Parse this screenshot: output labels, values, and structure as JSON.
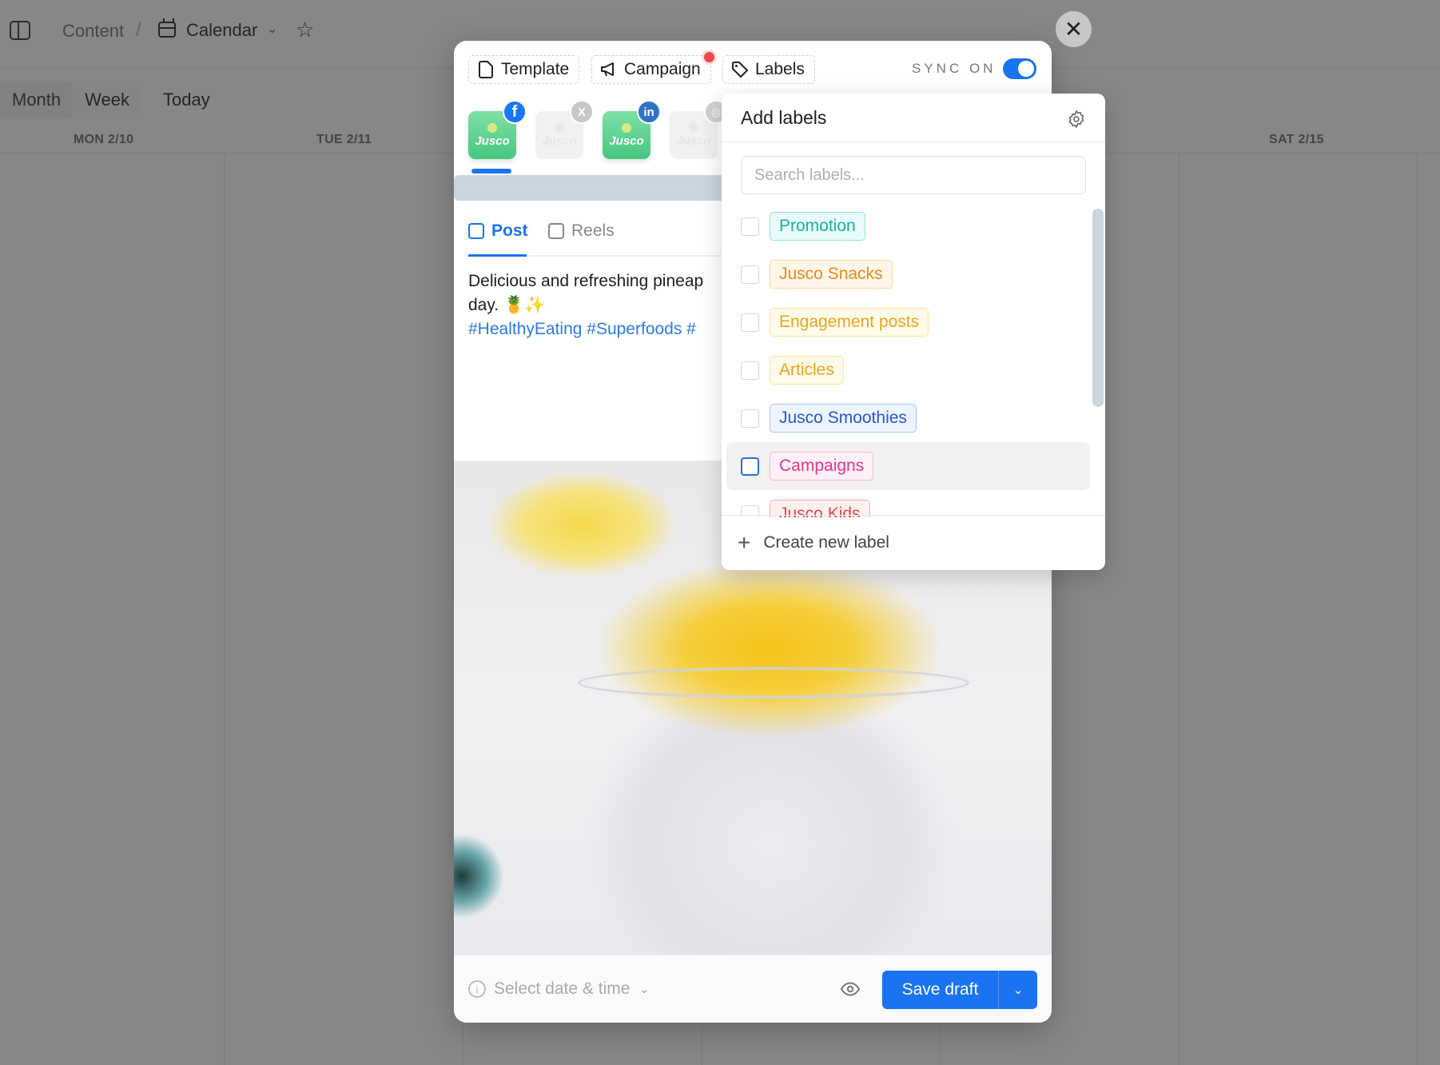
{
  "breadcrumb": {
    "parent": "Content",
    "separator": "/",
    "current": "Calendar"
  },
  "views": {
    "month": "Month",
    "week": "Week",
    "today": "Today",
    "active": "Week"
  },
  "days": [
    "MON 2/10",
    "TUE 2/11",
    "SAT 2/15"
  ],
  "modal": {
    "chips": {
      "template": "Template",
      "campaign": "Campaign",
      "labels": "Labels"
    },
    "sync_label": "SYNC ON",
    "sync_on": true,
    "accounts": [
      {
        "name": "Jusco",
        "network": "facebook",
        "badge": "f",
        "selected": true
      },
      {
        "name": "Jusco",
        "network": "x",
        "badge": "X",
        "selected": false
      },
      {
        "name": "Jusco",
        "network": "linkedin",
        "badge": "in",
        "selected": true
      },
      {
        "name": "Jusco",
        "network": "instagram",
        "badge": "◎",
        "selected": false
      }
    ],
    "tabs": {
      "post": "Post",
      "reels": "Reels",
      "active": "Post"
    },
    "post_text_line1": "Delicious and refreshing pineap",
    "post_text_line2": "day. 🍍✨",
    "post_hashtags": "#HealthyEating #Superfoods #",
    "footer": {
      "date_placeholder": "Select date & time",
      "save_label": "Save draft"
    }
  },
  "labels_popup": {
    "title": "Add labels",
    "search_placeholder": "Search labels...",
    "create_label": "Create new label",
    "labels": [
      {
        "name": "Promotion",
        "color": "#17b3a6",
        "bg": "#e9fbf8",
        "border": "#8fe3d8",
        "checked": false
      },
      {
        "name": "Jusco Snacks",
        "color": "#ec8a1c",
        "bg": "#fff6e8",
        "border": "#fbd49a",
        "checked": false
      },
      {
        "name": "Engagement posts",
        "color": "#e9a51d",
        "bg": "#fffbea",
        "border": "#fbe39a",
        "checked": false
      },
      {
        "name": "Articles",
        "color": "#e9a51d",
        "bg": "#fffbea",
        "border": "#fbe39a",
        "checked": false
      },
      {
        "name": "Jusco Smoothies",
        "color": "#2857c9",
        "bg": "#eef4fe",
        "border": "#a9c4f0",
        "checked": false
      },
      {
        "name": "Campaigns",
        "color": "#e0368f",
        "bg": "#fef0f6",
        "border": "#f6b6d3",
        "checked": false,
        "hovered": true
      },
      {
        "name": "Jusco Kids",
        "color": "#e2444a",
        "bg": "#fff0f0",
        "border": "#f5aaaa",
        "checked": false
      }
    ]
  },
  "colors": {
    "accent": "#1a73f0",
    "overlay": "rgba(40,40,40,0.55)"
  }
}
